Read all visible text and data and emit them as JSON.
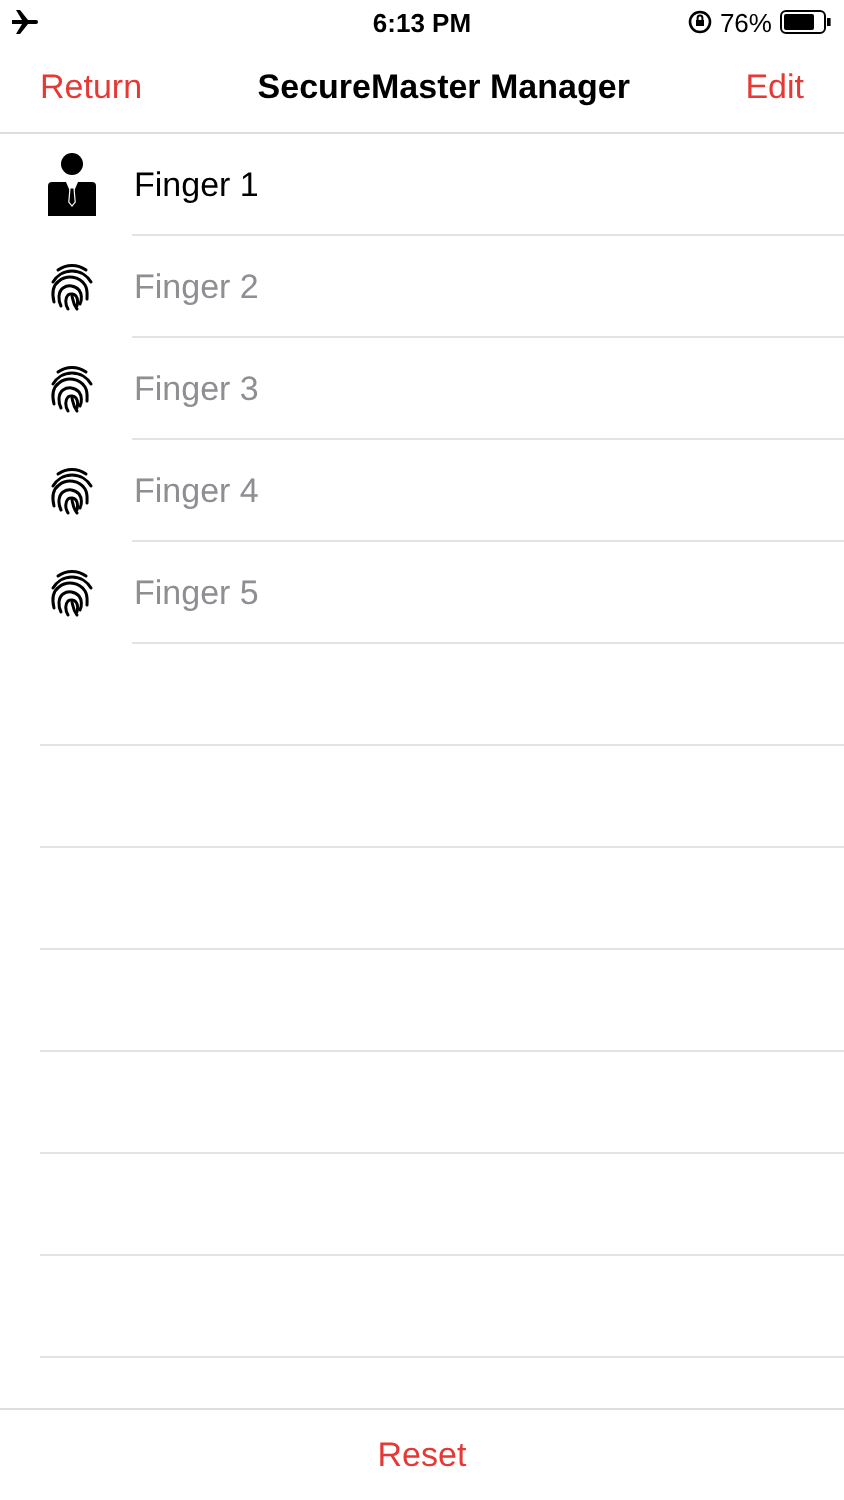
{
  "status_bar": {
    "time": "6:13 PM",
    "battery": "76%",
    "airplane_mode": true,
    "rotation_lock": true
  },
  "nav": {
    "back": "Return",
    "title": "SecureMaster Manager",
    "action": "Edit"
  },
  "items": [
    {
      "kind": "user",
      "label": "Finger 1",
      "active": true
    },
    {
      "kind": "fingerprint",
      "label": "Finger 2",
      "active": false
    },
    {
      "kind": "fingerprint",
      "label": "Finger 3",
      "active": false
    },
    {
      "kind": "fingerprint",
      "label": "Finger 4",
      "active": false
    },
    {
      "kind": "fingerprint",
      "label": "Finger 5",
      "active": false
    }
  ],
  "footer": {
    "button": "Reset"
  }
}
